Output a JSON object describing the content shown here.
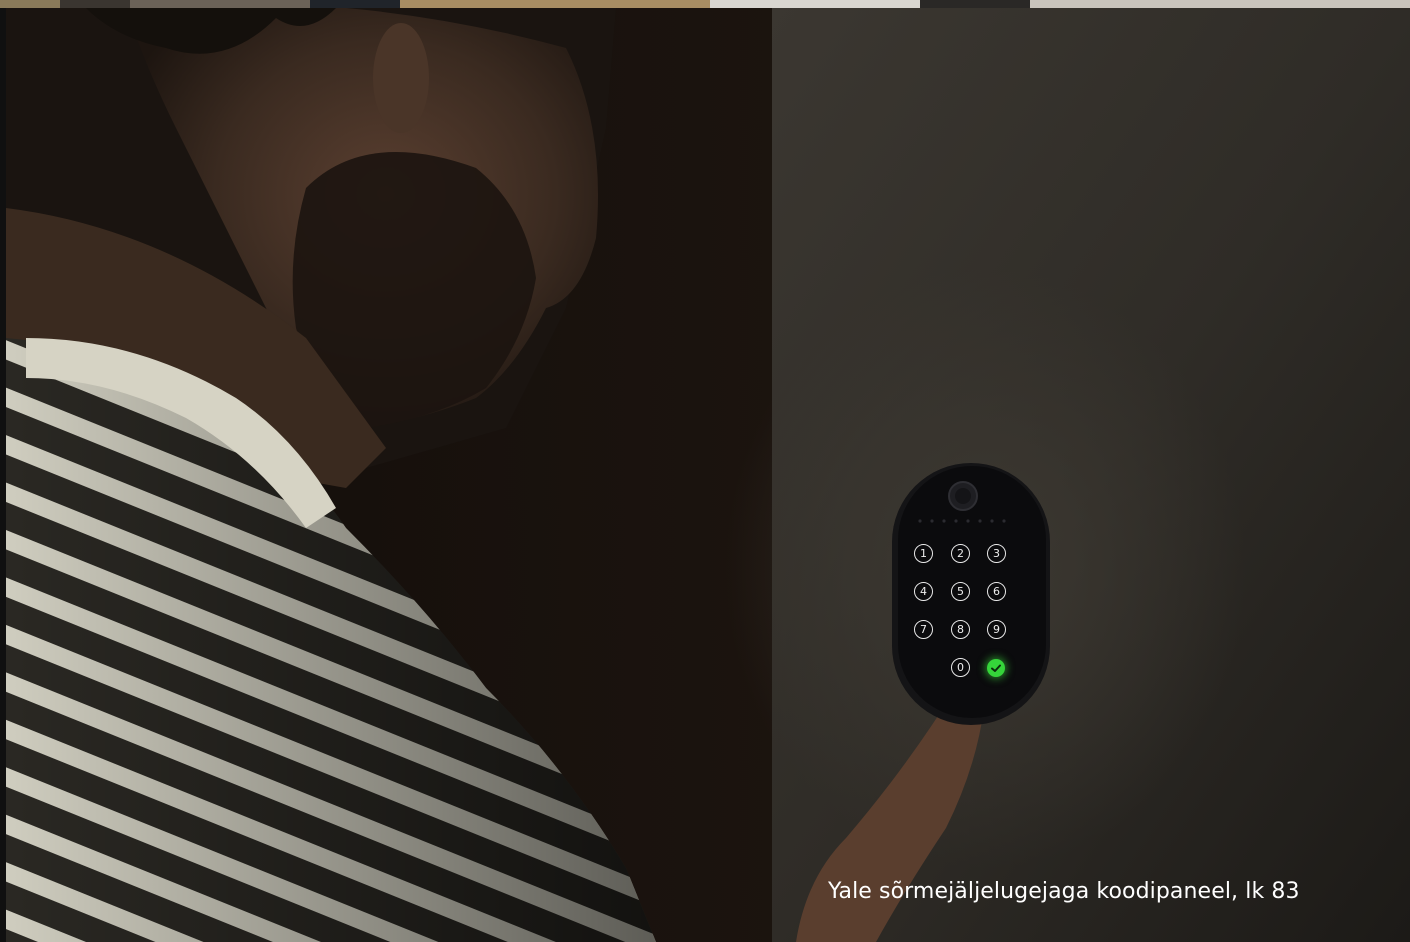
{
  "caption": "Yale sõrmejäljelugejaga koodipaneel, lk 83",
  "keypad": {
    "keys": [
      "1",
      "2",
      "3",
      "4",
      "5",
      "6",
      "7",
      "8",
      "9",
      "0"
    ],
    "confirm_icon": "check-icon",
    "confirm_color": "#35d43a"
  },
  "colors": {
    "wall_light": "#3a3630",
    "wall_dark": "#1b1714",
    "shirt_stripe_light": "#d8d6c8",
    "shirt_stripe_dark": "#2b2a24",
    "device_body": "#0b0b0d"
  }
}
